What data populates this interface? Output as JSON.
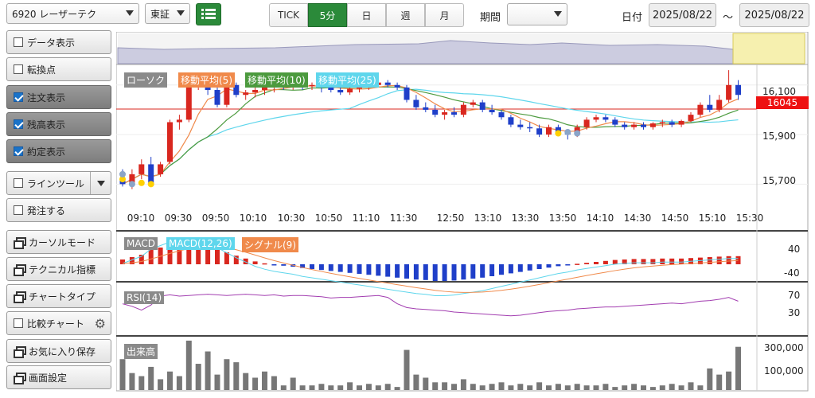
{
  "header": {
    "stock": "6920 レーザーテク",
    "market": "東証",
    "intervals": [
      "TICK",
      "5分",
      "日",
      "週",
      "月"
    ],
    "active_interval": "5分",
    "period_label": "期間",
    "period_value": "",
    "date_label": "日付",
    "date_from": "2025/08/22",
    "date_sep": "～",
    "date_to": "2025/08/22"
  },
  "sidebar": {
    "items": [
      {
        "label": "データ表示",
        "kind": "check",
        "on": false
      },
      {
        "label": "転換点",
        "kind": "check",
        "on": false
      },
      {
        "label": "注文表示",
        "kind": "check",
        "on": true
      },
      {
        "label": "残高表示",
        "kind": "check",
        "on": true
      },
      {
        "label": "約定表示",
        "kind": "check",
        "on": true
      },
      {
        "label": "ラインツール",
        "kind": "check-split",
        "on": false
      },
      {
        "label": "発注する",
        "kind": "check",
        "on": false
      },
      {
        "label": "カーソルモード",
        "kind": "window"
      },
      {
        "label": "テクニカル指標",
        "kind": "window"
      },
      {
        "label": "チャートタイプ",
        "kind": "window"
      },
      {
        "label": "比較チャート",
        "kind": "check-gear",
        "on": false
      },
      {
        "label": "お気に入り保存",
        "kind": "window"
      },
      {
        "label": "画面設定",
        "kind": "window"
      }
    ]
  },
  "legend": {
    "candle": "ローソク",
    "ma5": "移動平均(5)",
    "ma10": "移動平均(10)",
    "ma25": "移動平均(25)",
    "macd": "MACD",
    "macd_line": "MACD(12,26)",
    "signal": "シグナル(9)",
    "rsi": "RSI(14)",
    "volume": "出来高"
  },
  "colors": {
    "up": "#d9271f",
    "down": "#1f3fc9",
    "ma5": "#f08a4b",
    "ma10": "#4c9a3e",
    "ma25": "#5fd6ec",
    "rsi": "#a23db0",
    "volume": "#777777",
    "accent": "#2b8a3a",
    "current_price_bg": "#ee1111"
  },
  "price_axis": [
    "16,100",
    "15,900",
    "15,700"
  ],
  "current_price": "16045",
  "time_axis": [
    "09:10",
    "09:30",
    "09:50",
    "10:10",
    "10:30",
    "10:50",
    "11:10",
    "11:30",
    "12:50",
    "13:10",
    "13:30",
    "13:50",
    "14:10",
    "14:30",
    "14:50",
    "15:10",
    "15:30"
  ],
  "macd_axis": [
    "40",
    "-40"
  ],
  "rsi_axis": [
    "70",
    "30"
  ],
  "volume_axis": [
    "300,000",
    "100,000"
  ],
  "chart_data": {
    "type": "candlestick",
    "ylim": [
      15640,
      16170
    ],
    "candles": [
      [
        15720,
        15760,
        15690,
        15700
      ],
      [
        15700,
        15760,
        15680,
        15740
      ],
      [
        15740,
        15800,
        15720,
        15780
      ],
      [
        15780,
        15810,
        15690,
        15700
      ],
      [
        15740,
        15790,
        15730,
        15780
      ],
      [
        15790,
        15960,
        15780,
        15950
      ],
      [
        15950,
        15980,
        15920,
        15960
      ],
      [
        15960,
        16110,
        15950,
        16100
      ],
      [
        16100,
        16130,
        16080,
        16120
      ],
      [
        16120,
        16140,
        16060,
        16080
      ],
      [
        16080,
        16100,
        16010,
        16020
      ],
      [
        16020,
        16110,
        16010,
        16100
      ],
      [
        16100,
        16110,
        16050,
        16060
      ],
      [
        16060,
        16080,
        16040,
        16070
      ],
      [
        16070,
        16090,
        16050,
        16080
      ],
      [
        16080,
        16100,
        16060,
        16090
      ],
      [
        16090,
        16110,
        16070,
        16100
      ],
      [
        16100,
        16110,
        16080,
        16090
      ],
      [
        16090,
        16110,
        16080,
        16100
      ],
      [
        16100,
        16110,
        16080,
        16095
      ],
      [
        16095,
        16110,
        16080,
        16100
      ],
      [
        16100,
        16110,
        16070,
        16090
      ],
      [
        16090,
        16100,
        16070,
        16080
      ],
      [
        16080,
        16100,
        16060,
        16070
      ],
      [
        16070,
        16090,
        16060,
        16085
      ],
      [
        16085,
        16100,
        16070,
        16090
      ],
      [
        16090,
        16110,
        16080,
        16100
      ],
      [
        16100,
        16115,
        16090,
        16110
      ],
      [
        16110,
        16120,
        16090,
        16100
      ],
      [
        16100,
        16110,
        16080,
        16090
      ],
      [
        16090,
        16100,
        16030,
        16040
      ],
      [
        16040,
        16060,
        16000,
        16010
      ],
      [
        16010,
        16030,
        15990,
        16000
      ],
      [
        16000,
        16020,
        15970,
        15980
      ],
      [
        15980,
        16000,
        15960,
        15990
      ],
      [
        15990,
        16010,
        15970,
        15980
      ],
      [
        15980,
        16030,
        15970,
        16020
      ],
      [
        16020,
        16040,
        16010,
        16030
      ],
      [
        16030,
        16040,
        15990,
        16000
      ],
      [
        16000,
        16020,
        15980,
        15990
      ],
      [
        15990,
        16000,
        15960,
        15970
      ],
      [
        15970,
        15980,
        15930,
        15940
      ],
      [
        15940,
        15960,
        15920,
        15930
      ],
      [
        15930,
        15950,
        15910,
        15925
      ],
      [
        15925,
        15940,
        15890,
        15900
      ],
      [
        15900,
        15940,
        15890,
        15930
      ],
      [
        15930,
        15940,
        15900,
        15910
      ],
      [
        15910,
        15920,
        15880,
        15900
      ],
      [
        15900,
        15940,
        15890,
        15930
      ],
      [
        15930,
        15970,
        15920,
        15960
      ],
      [
        15960,
        15980,
        15950,
        15970
      ],
      [
        15970,
        15980,
        15950,
        15960
      ],
      [
        15960,
        15970,
        15930,
        15940
      ],
      [
        15940,
        15950,
        15920,
        15930
      ],
      [
        15930,
        15950,
        15920,
        15940
      ],
      [
        15940,
        15950,
        15920,
        15930
      ],
      [
        15930,
        15950,
        15920,
        15945
      ],
      [
        15945,
        15960,
        15930,
        15950
      ],
      [
        15950,
        15960,
        15930,
        15940
      ],
      [
        15940,
        15960,
        15930,
        15955
      ],
      [
        15955,
        15990,
        15950,
        15980
      ],
      [
        15980,
        16030,
        15970,
        16020
      ],
      [
        16020,
        16060,
        15990,
        16000
      ],
      [
        16000,
        16060,
        15990,
        16040
      ],
      [
        16040,
        16160,
        16030,
        16100
      ],
      [
        16100,
        16120,
        16040,
        16060
      ]
    ],
    "volume": [
      200000,
      110000,
      90000,
      150000,
      70000,
      120000,
      90000,
      320000,
      170000,
      250000,
      100000,
      200000,
      180000,
      110000,
      80000,
      120000,
      90000,
      30000,
      80000,
      30000,
      30000,
      40000,
      30000,
      30000,
      50000,
      30000,
      40000,
      30000,
      40000,
      20000,
      260000,
      100000,
      80000,
      50000,
      50000,
      40000,
      70000,
      40000,
      30000,
      40000,
      50000,
      30000,
      40000,
      30000,
      50000,
      30000,
      40000,
      30000,
      40000,
      30000,
      30000,
      40000,
      20000,
      30000,
      40000,
      30000,
      20000,
      30000,
      40000,
      30000,
      50000,
      30000,
      140000,
      100000,
      120000,
      280000
    ],
    "macd_hist": [
      10,
      15,
      20,
      30,
      35,
      40,
      42,
      44,
      42,
      38,
      32,
      25,
      18,
      12,
      6,
      2,
      -1,
      -3,
      -5,
      -8,
      -10,
      -12,
      -14,
      -16,
      -18,
      -20,
      -22,
      -24,
      -26,
      -28,
      -30,
      -32,
      -33,
      -35,
      -35,
      -34,
      -32,
      -30,
      -28,
      -25,
      -22,
      -19,
      -16,
      -13,
      -10,
      -7,
      -4,
      -2,
      1,
      3,
      5,
      7,
      9,
      10,
      11,
      11,
      11,
      12,
      12,
      12,
      13,
      14,
      15,
      16,
      17,
      17
    ],
    "rsi": [
      58,
      54,
      48,
      56,
      70,
      72,
      70,
      71,
      72,
      73,
      72,
      71,
      72,
      73,
      72,
      71,
      72,
      70,
      71,
      71,
      70,
      69,
      67,
      68,
      68,
      69,
      70,
      71,
      68,
      58,
      52,
      50,
      49,
      48,
      47,
      45,
      44,
      43,
      42,
      41,
      40,
      39,
      40,
      42,
      44,
      46,
      47,
      48,
      50,
      51,
      52,
      53,
      53,
      54,
      55,
      56,
      57,
      58,
      59,
      58,
      60,
      62,
      63,
      65,
      68,
      62
    ]
  }
}
